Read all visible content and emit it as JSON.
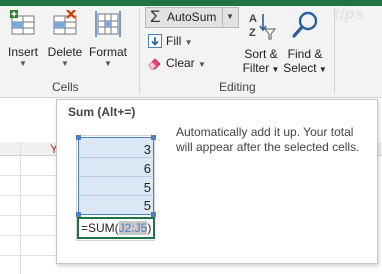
{
  "ribbon": {
    "cells_group": {
      "label": "Cells",
      "insert": "Insert",
      "delete": "Delete",
      "format": "Format"
    },
    "editing_group": {
      "label": "Editing",
      "autosum": "AutoSum",
      "fill": "Fill",
      "clear": "Clear",
      "sort_filter_line1": "Sort &",
      "sort_filter_line2": "Filter",
      "find_select_line1": "Find &",
      "find_select_line2": "Select"
    },
    "accent_color": "#217346"
  },
  "grid": {
    "column_letter": "Y"
  },
  "tooltip": {
    "title": "Sum (Alt+=)",
    "description": "Automatically add it up. Your total will appear after the selected cells.",
    "example_values": [
      "3",
      "6",
      "5",
      "5"
    ],
    "formula_prefix": "=SUM(",
    "formula_range": "J2:J5",
    "formula_suffix": ")"
  },
  "watermark": "tips"
}
